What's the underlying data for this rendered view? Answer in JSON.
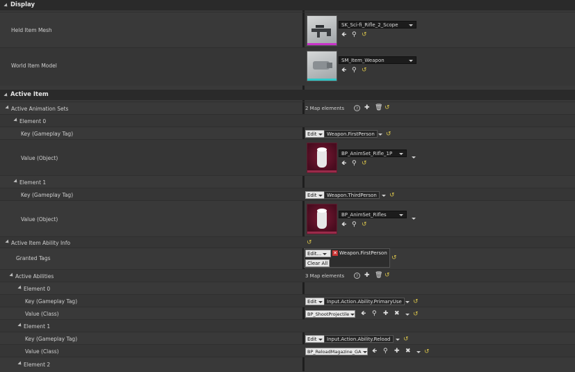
{
  "categories": {
    "display": "Display",
    "active_item": "Active Item"
  },
  "display": {
    "held_item_mesh": {
      "label": "Held Item Mesh",
      "value": "SK_Sci-fi_Rifle_2_Scope"
    },
    "world_item_model": {
      "label": "World Item Model",
      "value": "SM_Item_Weapon"
    }
  },
  "active_animation_sets": {
    "label": "Active Animation Sets",
    "count": "2 Map elements",
    "elements": [
      {
        "label": "Element 0",
        "key_label": "Key (Gameplay Tag)",
        "key": "Weapon.FirstPerson",
        "value_label": "Value (Object)",
        "value": "BP_AnimSet_Rifle_1P"
      },
      {
        "label": "Element 1",
        "key_label": "Key (Gameplay Tag)",
        "key": "Weapon.ThirdPerson",
        "value_label": "Value (Object)",
        "value": "BP_AnimSet_Rifles"
      }
    ]
  },
  "ability_info": {
    "label": "Active Item Ability Info",
    "granted_tags_label": "Granted Tags",
    "granted_tag": "Weapon.FirstPerson",
    "edit": "Edit...",
    "clear_all": "Clear All"
  },
  "active_abilities": {
    "label": "Active Abilities",
    "count": "3 Map elements",
    "elements": [
      {
        "label": "Element 0",
        "key_label": "Key (Gameplay Tag)",
        "key": "Input.Action.Ability.PrimaryUse",
        "value_label": "Value (Class)",
        "value": "BP_ShootProjectile"
      },
      {
        "label": "Element 1",
        "key_label": "Key (Gameplay Tag)",
        "key": "Input.Action.Ability.Reload",
        "value_label": "Value (Class)",
        "value": "BP_ReloadMagazine_GA"
      },
      {
        "label": "Element 2"
      }
    ]
  },
  "edit_label": "Edit",
  "colors": {
    "mesh_bar": "#c832c8",
    "model_bar": "#30c8c8",
    "anim_bg": "#5a1226"
  }
}
